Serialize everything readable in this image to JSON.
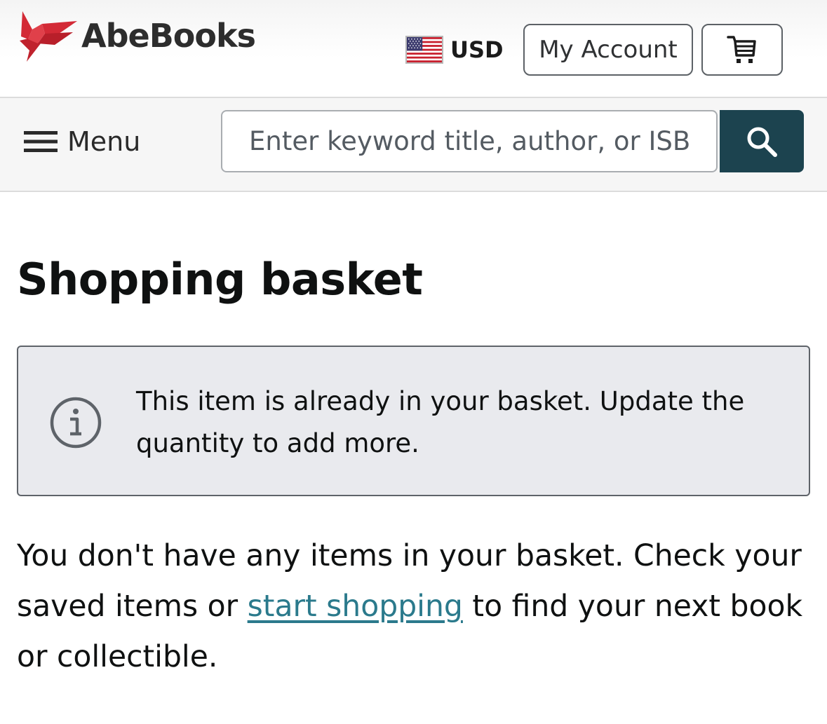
{
  "header": {
    "logo_text": "AbeBooks",
    "currency_label": "USD",
    "account_label": "My Account"
  },
  "search": {
    "menu_label": "Menu",
    "placeholder": "Enter keyword title, author, or ISBN"
  },
  "main": {
    "title": "Shopping basket",
    "alert_text": "This item is already in your basket. Update the quantity to add more.",
    "empty_text_before": "You don't have any items in your basket. Check your saved items or ",
    "empty_link": "start shopping",
    "empty_text_after": " to find your next book or collectible."
  },
  "colors": {
    "brand_red": "#d32a36",
    "search_button": "#1c434f",
    "link": "#2b7a8c",
    "alert_bg": "#e9eaee"
  },
  "icons": {
    "logo": "abebooks-bird-logo",
    "currency": "us-flag-icon",
    "cart": "cart-icon",
    "menu": "hamburger-icon",
    "search": "search-icon",
    "alert": "info-icon"
  }
}
